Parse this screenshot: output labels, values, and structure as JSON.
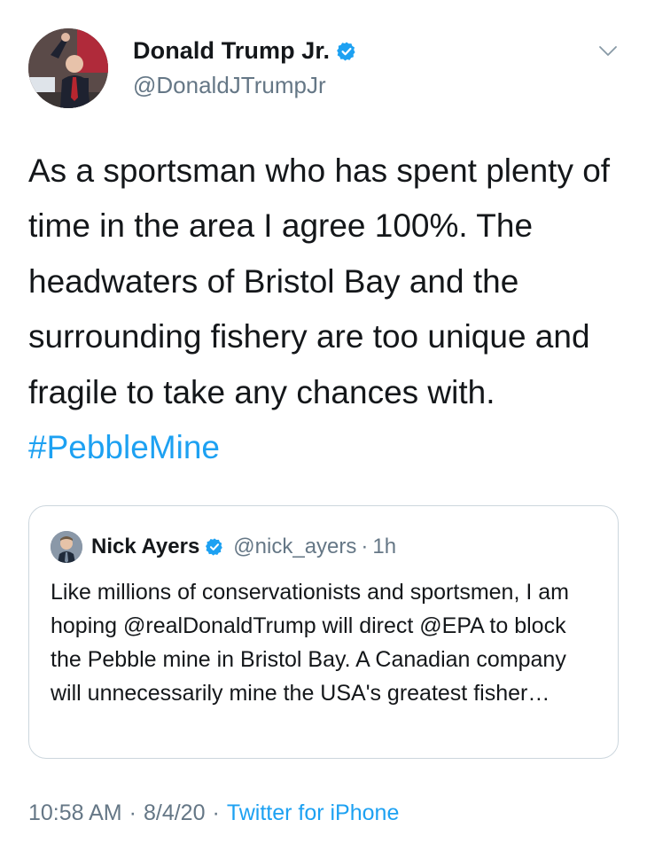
{
  "author": {
    "display_name": "Donald Trump Jr.",
    "handle": "@DonaldJTrumpJr",
    "verified": true,
    "avatar_icon": "profile-photo-icon"
  },
  "tweet": {
    "text": "As a sportsman who has spent plenty of time in the area I agree 100%. The headwaters of Bristol Bay and the surrounding fishery are too unique and fragile to take any chances with. ",
    "hashtag": "#PebbleMine"
  },
  "quoted_tweet": {
    "display_name": "Nick Ayers",
    "handle": "@nick_ayers",
    "separator": "·",
    "time": "1h",
    "verified": true,
    "text": "Like millions of conservationists and sportsmen, I am hoping @realDonaldTrump will direct @EPA to block the Pebble mine in Bristol Bay. A Canadian company will unnecessarily mine the USA's greatest fisher…"
  },
  "meta": {
    "time": "10:58 AM",
    "date": "8/4/20",
    "separator": "·",
    "source": "Twitter for iPhone"
  },
  "colors": {
    "link": "#1da1f2",
    "secondary_text": "#657786",
    "primary_text": "#14171a",
    "border": "#ccd6dd"
  }
}
